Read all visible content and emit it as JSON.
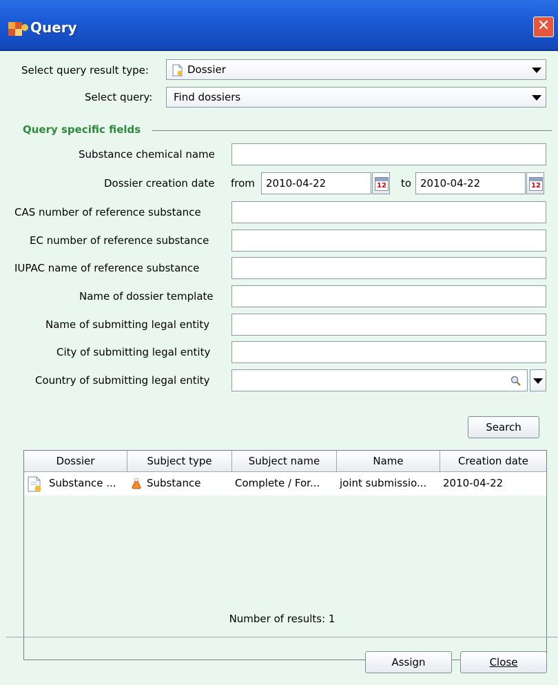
{
  "window": {
    "title": "Query",
    "close_label": "✕"
  },
  "query_result_type": {
    "label": "Select query result type:",
    "value": "Dossier"
  },
  "select_query": {
    "label": "Select query:",
    "value": "Find dossiers"
  },
  "section": {
    "title": "Query specific fields"
  },
  "fields": {
    "substance_name": {
      "label": "Substance chemical name",
      "value": ""
    },
    "creation_date": {
      "label": "Dossier creation date",
      "from_label": "from",
      "from": "2010-04-22",
      "to_label": "to",
      "to": "2010-04-22",
      "calendar_day": "12"
    },
    "cas_number": {
      "label": "CAS number of reference substance",
      "value": ""
    },
    "ec_number": {
      "label": "EC number of reference substance",
      "value": ""
    },
    "iupac_name": {
      "label": "IUPAC name of reference substance",
      "value": ""
    },
    "template_name": {
      "label": "Name of dossier template",
      "value": ""
    },
    "legal_entity_name": {
      "label": "Name of submitting legal entity",
      "value": ""
    },
    "legal_entity_city": {
      "label": "City of submitting legal entity",
      "value": ""
    },
    "legal_entity_country": {
      "label": "Country of submitting legal entity",
      "value": ""
    }
  },
  "search_button": "Search",
  "table": {
    "columns": [
      "Dossier",
      "Subject type",
      "Subject name",
      "Name",
      "Creation date"
    ],
    "rows": [
      {
        "dossier": "Substance ...",
        "subject_type": "Substance",
        "subject_name": "Complete / For...",
        "name": "joint submissio...",
        "creation_date": "2010-04-22"
      }
    ]
  },
  "results_text": "Number of results:  1",
  "assign_button": "Assign",
  "close_button": "Close"
}
